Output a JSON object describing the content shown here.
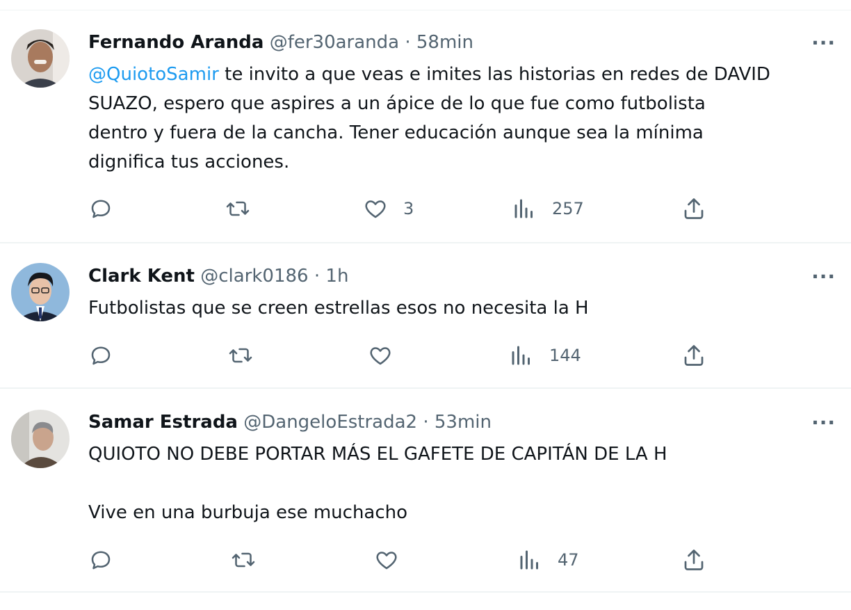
{
  "tweets": [
    {
      "name": "Fernando Aranda",
      "handle": "@fer30aranda",
      "time": "58min",
      "separator": "·",
      "more_label": "···",
      "mention": "@QuiotoSamir",
      "text": " te invito a que veas e imites las historias en redes de DAVID\nSUAZO, espero que aspires a un ápice de lo que fue como futbolista\ndentro y fuera de la cancha. Tener educación aunque sea la mínima\ndignifica tus acciones.",
      "likes": "3",
      "views": "257"
    },
    {
      "name": "Clark Kent",
      "handle": "@clark0186",
      "time": "1h",
      "separator": "·",
      "more_label": "···",
      "text": "Futbolistas que se creen estrellas esos no necesita la H",
      "likes": "",
      "views": "144"
    },
    {
      "name": "Samar Estrada",
      "handle": "@DangeloEstrada2",
      "time": "53min",
      "separator": "·",
      "more_label": "···",
      "text": "QUIOTO NO DEBE PORTAR MÁS EL GAFETE DE CAPITÁN DE LA H\n\nVive en una burbuja ese muchacho",
      "likes": "",
      "views": "47"
    }
  ],
  "icons": {
    "reply": "reply-icon",
    "retweet": "retweet-icon",
    "like": "heart-icon",
    "views": "views-icon",
    "share": "share-icon"
  },
  "colors": {
    "text": "#0f1419",
    "secondary": "#536471",
    "link": "#1d9bf0",
    "divider": "#eff3f4"
  }
}
